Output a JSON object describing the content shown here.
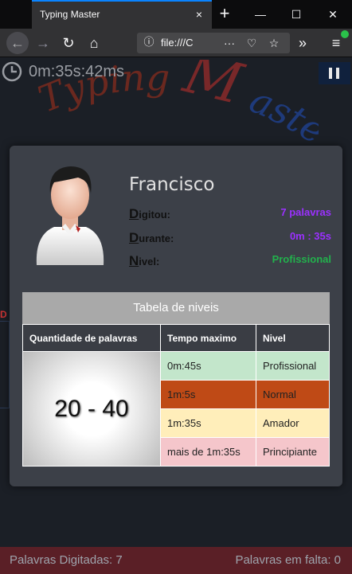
{
  "browser": {
    "tab_title": "Typing Master",
    "url": "file:///C",
    "tab_close_icon": "×",
    "new_tab_icon": "+",
    "minimize_icon": "—",
    "maximize_icon": "☐",
    "close_icon": "✕",
    "back_icon": "←",
    "forward_icon": "→",
    "reload_icon": "↻",
    "home_icon": "⌂",
    "info_icon": "ⓘ",
    "more_icon": "···",
    "pocket_icon": "♡",
    "bookmark_icon": "☆",
    "overflow_icon": "»",
    "menu_icon": "≡"
  },
  "timer": {
    "text": "0m:35s:42ms"
  },
  "logo": {
    "typing": "Typing",
    "master_initial": "M",
    "master_rest": "aster"
  },
  "left_mark": "D",
  "profile": {
    "name": "Francisco",
    "rows": [
      {
        "initial": "D",
        "label": "igitou:",
        "value": "7 palavras",
        "color": "#9b30ff"
      },
      {
        "initial": "D",
        "label": "urante:",
        "value": "0m : 35s",
        "color": "#9b30ff"
      },
      {
        "initial": "N",
        "label": "ivel:",
        "value": "Profissional",
        "color": "#22b14c"
      }
    ]
  },
  "levels_table": {
    "caption": "Tabela de niveis",
    "headers": [
      "Quantidade de palavras",
      "Tempo maximo",
      "Nivel"
    ],
    "range": "20 - 40",
    "rows": [
      {
        "time": "0m:45s",
        "level": "Profissional",
        "color": "#c3e6cb"
      },
      {
        "time": "1m:5s",
        "level": "Normal",
        "color": "#bf4a16"
      },
      {
        "time": "1m:35s",
        "level": "Amador",
        "color": "#ffeeba"
      },
      {
        "time": "mais de 1m:35s",
        "level": "Principiante",
        "color": "#f5c6cb"
      }
    ]
  },
  "footer": {
    "typed": "Palavras Digitadas: 7",
    "remaining": "Palavras em falta: 0"
  }
}
